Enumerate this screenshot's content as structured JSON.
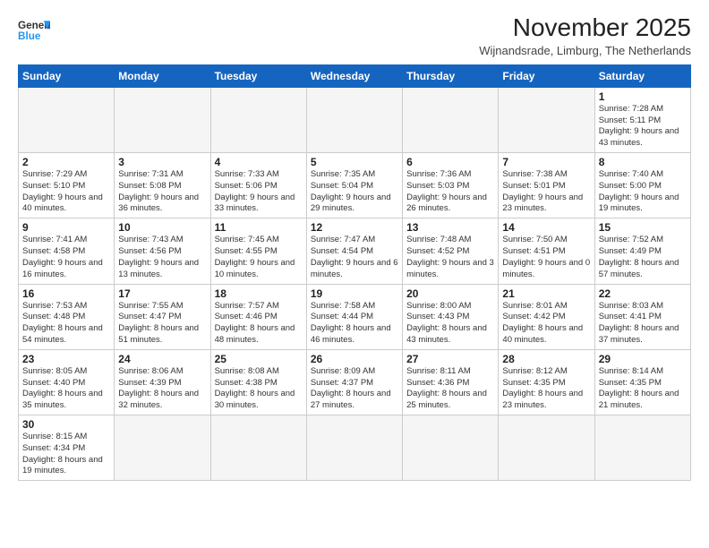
{
  "logo": {
    "line1": "General",
    "line2": "Blue"
  },
  "title": "November 2025",
  "subtitle": "Wijnandsrade, Limburg, The Netherlands",
  "weekdays": [
    "Sunday",
    "Monday",
    "Tuesday",
    "Wednesday",
    "Thursday",
    "Friday",
    "Saturday"
  ],
  "weeks": [
    [
      {
        "day": "",
        "info": ""
      },
      {
        "day": "",
        "info": ""
      },
      {
        "day": "",
        "info": ""
      },
      {
        "day": "",
        "info": ""
      },
      {
        "day": "",
        "info": ""
      },
      {
        "day": "",
        "info": ""
      },
      {
        "day": "1",
        "info": "Sunrise: 7:28 AM\nSunset: 5:11 PM\nDaylight: 9 hours and 43 minutes."
      }
    ],
    [
      {
        "day": "2",
        "info": "Sunrise: 7:29 AM\nSunset: 5:10 PM\nDaylight: 9 hours and 40 minutes."
      },
      {
        "day": "3",
        "info": "Sunrise: 7:31 AM\nSunset: 5:08 PM\nDaylight: 9 hours and 36 minutes."
      },
      {
        "day": "4",
        "info": "Sunrise: 7:33 AM\nSunset: 5:06 PM\nDaylight: 9 hours and 33 minutes."
      },
      {
        "day": "5",
        "info": "Sunrise: 7:35 AM\nSunset: 5:04 PM\nDaylight: 9 hours and 29 minutes."
      },
      {
        "day": "6",
        "info": "Sunrise: 7:36 AM\nSunset: 5:03 PM\nDaylight: 9 hours and 26 minutes."
      },
      {
        "day": "7",
        "info": "Sunrise: 7:38 AM\nSunset: 5:01 PM\nDaylight: 9 hours and 23 minutes."
      },
      {
        "day": "8",
        "info": "Sunrise: 7:40 AM\nSunset: 5:00 PM\nDaylight: 9 hours and 19 minutes."
      }
    ],
    [
      {
        "day": "9",
        "info": "Sunrise: 7:41 AM\nSunset: 4:58 PM\nDaylight: 9 hours and 16 minutes."
      },
      {
        "day": "10",
        "info": "Sunrise: 7:43 AM\nSunset: 4:56 PM\nDaylight: 9 hours and 13 minutes."
      },
      {
        "day": "11",
        "info": "Sunrise: 7:45 AM\nSunset: 4:55 PM\nDaylight: 9 hours and 10 minutes."
      },
      {
        "day": "12",
        "info": "Sunrise: 7:47 AM\nSunset: 4:54 PM\nDaylight: 9 hours and 6 minutes."
      },
      {
        "day": "13",
        "info": "Sunrise: 7:48 AM\nSunset: 4:52 PM\nDaylight: 9 hours and 3 minutes."
      },
      {
        "day": "14",
        "info": "Sunrise: 7:50 AM\nSunset: 4:51 PM\nDaylight: 9 hours and 0 minutes."
      },
      {
        "day": "15",
        "info": "Sunrise: 7:52 AM\nSunset: 4:49 PM\nDaylight: 8 hours and 57 minutes."
      }
    ],
    [
      {
        "day": "16",
        "info": "Sunrise: 7:53 AM\nSunset: 4:48 PM\nDaylight: 8 hours and 54 minutes."
      },
      {
        "day": "17",
        "info": "Sunrise: 7:55 AM\nSunset: 4:47 PM\nDaylight: 8 hours and 51 minutes."
      },
      {
        "day": "18",
        "info": "Sunrise: 7:57 AM\nSunset: 4:46 PM\nDaylight: 8 hours and 48 minutes."
      },
      {
        "day": "19",
        "info": "Sunrise: 7:58 AM\nSunset: 4:44 PM\nDaylight: 8 hours and 46 minutes."
      },
      {
        "day": "20",
        "info": "Sunrise: 8:00 AM\nSunset: 4:43 PM\nDaylight: 8 hours and 43 minutes."
      },
      {
        "day": "21",
        "info": "Sunrise: 8:01 AM\nSunset: 4:42 PM\nDaylight: 8 hours and 40 minutes."
      },
      {
        "day": "22",
        "info": "Sunrise: 8:03 AM\nSunset: 4:41 PM\nDaylight: 8 hours and 37 minutes."
      }
    ],
    [
      {
        "day": "23",
        "info": "Sunrise: 8:05 AM\nSunset: 4:40 PM\nDaylight: 8 hours and 35 minutes."
      },
      {
        "day": "24",
        "info": "Sunrise: 8:06 AM\nSunset: 4:39 PM\nDaylight: 8 hours and 32 minutes."
      },
      {
        "day": "25",
        "info": "Sunrise: 8:08 AM\nSunset: 4:38 PM\nDaylight: 8 hours and 30 minutes."
      },
      {
        "day": "26",
        "info": "Sunrise: 8:09 AM\nSunset: 4:37 PM\nDaylight: 8 hours and 27 minutes."
      },
      {
        "day": "27",
        "info": "Sunrise: 8:11 AM\nSunset: 4:36 PM\nDaylight: 8 hours and 25 minutes."
      },
      {
        "day": "28",
        "info": "Sunrise: 8:12 AM\nSunset: 4:35 PM\nDaylight: 8 hours and 23 minutes."
      },
      {
        "day": "29",
        "info": "Sunrise: 8:14 AM\nSunset: 4:35 PM\nDaylight: 8 hours and 21 minutes."
      }
    ],
    [
      {
        "day": "30",
        "info": "Sunrise: 8:15 AM\nSunset: 4:34 PM\nDaylight: 8 hours and 19 minutes."
      },
      {
        "day": "",
        "info": ""
      },
      {
        "day": "",
        "info": ""
      },
      {
        "day": "",
        "info": ""
      },
      {
        "day": "",
        "info": ""
      },
      {
        "day": "",
        "info": ""
      },
      {
        "day": "",
        "info": ""
      }
    ]
  ]
}
